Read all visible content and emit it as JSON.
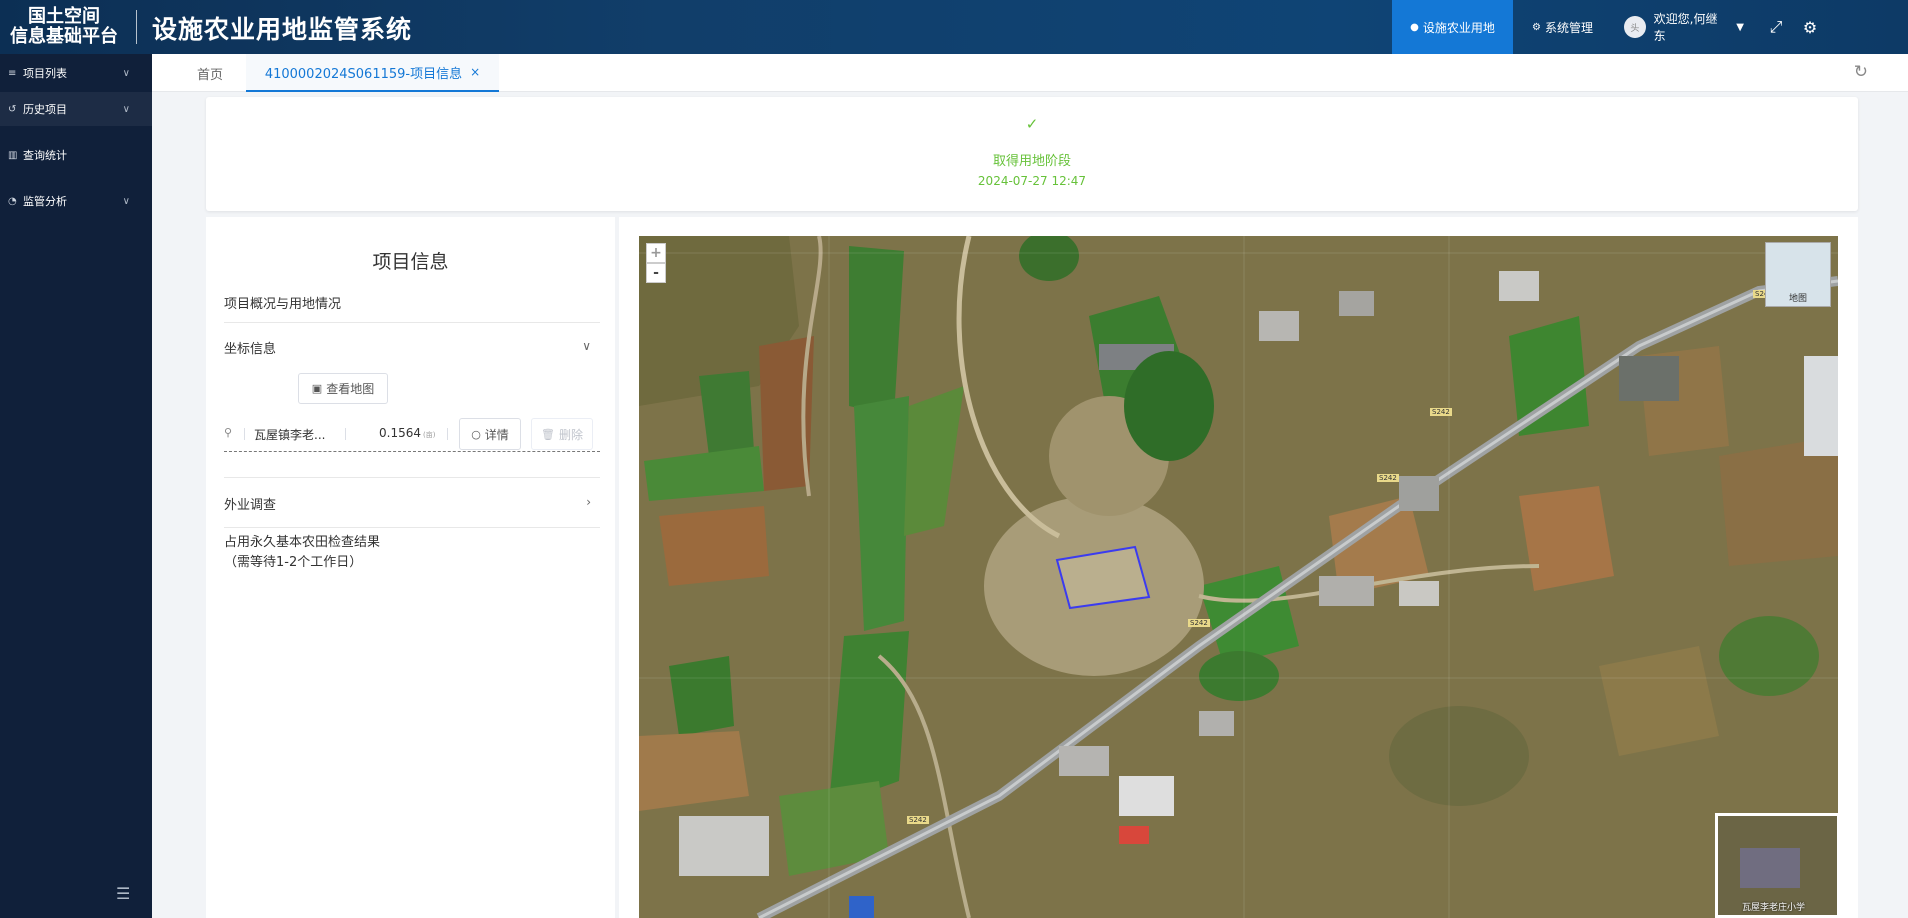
{
  "header": {
    "logo_line1": "国土空间",
    "logo_line2": "信息基础平台",
    "app_title": "设施农业用地监管系统",
    "nav_active_label": "设施农业用地",
    "nav_system_label": "系统管理",
    "user_greeting": "欢迎您,何继东",
    "avatar_text": "头"
  },
  "sidebar": {
    "items": [
      {
        "label": "项目列表"
      },
      {
        "label": "历史项目"
      },
      {
        "label": "查询统计"
      },
      {
        "label": "监管分析"
      }
    ]
  },
  "tabs": {
    "home_label": "首页",
    "active_label": "4100002024S061159-项目信息",
    "close_symbol": "×"
  },
  "status": {
    "stage": "取得用地阶段",
    "time": "2024-07-27 12:47"
  },
  "project_info": {
    "title": "项目信息",
    "overview_label": "项目概况与用地情况",
    "coord_section_label": "坐标信息",
    "view_map_button": "查看地图",
    "coord_name": "瓦屋镇李老...",
    "coord_area": "0.1564",
    "coord_area_unit": "(亩)",
    "detail_button": "详情",
    "delete_button": "删除",
    "field_survey_label": "外业调查",
    "check_result_line1": "占用永久基本农田检查结果",
    "check_result_line2": "（需等待1-2个工作日）"
  },
  "map": {
    "zoom_in": "+",
    "zoom_out": "-",
    "overview_label": "地图",
    "minimap_label": "瓦屋李老庄小学",
    "road_labels": [
      "S242",
      "S242",
      "S242",
      "S242",
      "S242"
    ]
  },
  "colors": {
    "header_bg": "#0f3a64",
    "sidebar_bg": "#10203a",
    "accent": "#1478d6",
    "success": "#67c23a",
    "parcel_outline": "#3b3bf0"
  }
}
